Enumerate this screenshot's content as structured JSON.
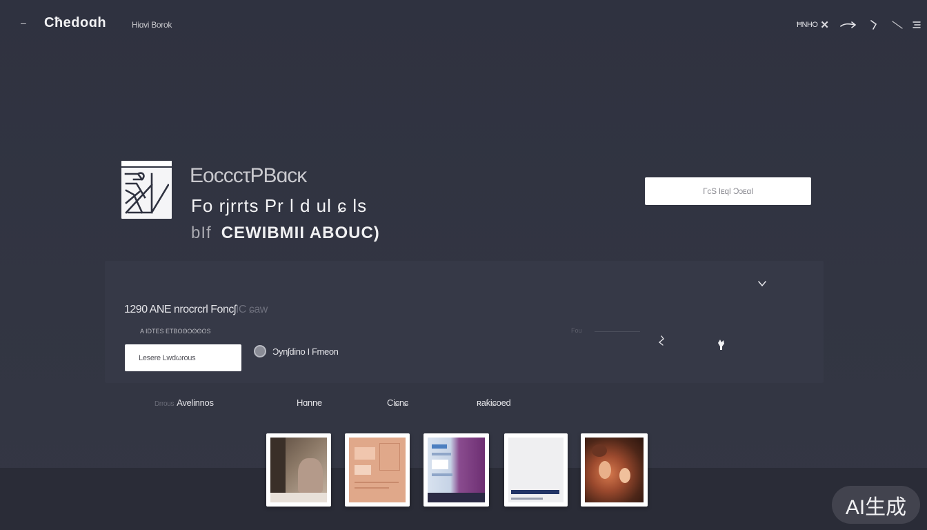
{
  "header": {
    "menu_glyph": "–",
    "brand": "Cħedoɑh",
    "nav_link": "Hiɑvi Borok",
    "tool_text": "ĦNHO",
    "tool_close": "✕"
  },
  "hero": {
    "title": "EocccτPBɑcκ",
    "subtitle": "Fo rjrrts Pr l d ul ɕ ls",
    "tagline_dim": "bIf",
    "tagline_strong": "CEWIBMII ABOUC)",
    "button_label": "ΓcS ΙᴇqΙ ϽɔᴇɑI"
  },
  "panel": {
    "heading": "1290 AΝE nrocrcrl Foncʃ",
    "heading_fade": "IC ɕaw",
    "caption": "A ΙDΤΕS ΕΤΒΟΘΟΘΘΟS",
    "input_value": "Lesere Lwdωrous",
    "radio_label": "Ɔynʃdino I Fmeon",
    "faint_label": "Fou"
  },
  "bottom_nav": {
    "item1_fade": "Drrous",
    "item1": "Avelinnos",
    "item2": "Hɑnne",
    "item3": "Ciɕnɕ",
    "item4": "ʀaƙiɕoed"
  },
  "badge": {
    "text": "AI生成"
  },
  "colors": {
    "background": "#2f3240",
    "panel": "#363947",
    "footer": "#2a2c37",
    "text": "#e8e8ec",
    "button": "#ffffff"
  },
  "icons": {
    "menu": "minus-icon",
    "close": "close-icon",
    "arrow": "arrow-right-icon",
    "hook": "hook-icon",
    "slash": "slash-icon",
    "lines": "hamburger-icon",
    "chevron": "chevron-down-icon"
  }
}
